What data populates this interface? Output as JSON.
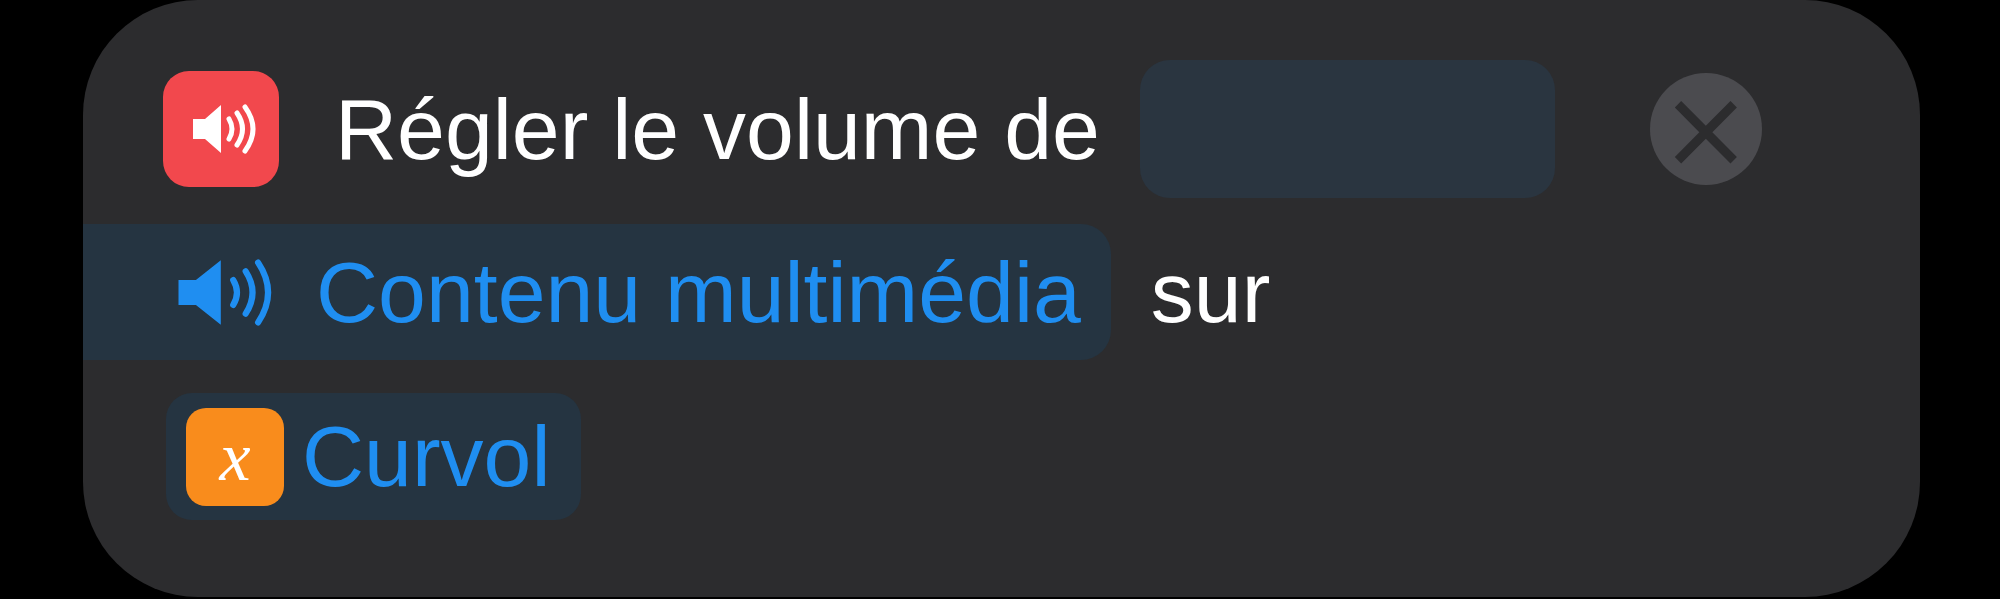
{
  "action": {
    "title": "Régler le volume de",
    "close": "×"
  },
  "parameter": {
    "label": "Contenu multimédia",
    "connector": "sur"
  },
  "variable": {
    "name": "Curvol",
    "symbol": "x"
  }
}
